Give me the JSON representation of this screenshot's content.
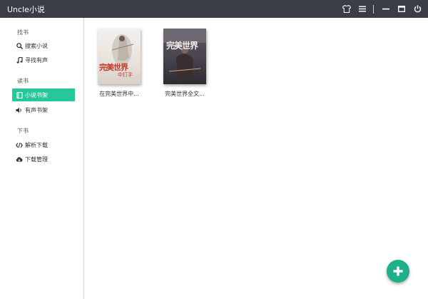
{
  "app": {
    "title": "Uncle小说"
  },
  "sidebar": {
    "sections": [
      {
        "label": "找书",
        "items": [
          {
            "label": "搜索小说",
            "icon": "search-icon"
          },
          {
            "label": "寻找有声",
            "icon": "music-note-icon"
          }
        ]
      },
      {
        "label": "读书",
        "items": [
          {
            "label": "小说书架",
            "icon": "book-icon",
            "active": true
          },
          {
            "label": "有声书架",
            "icon": "speaker-icon"
          }
        ]
      },
      {
        "label": "下书",
        "items": [
          {
            "label": "解析下载",
            "icon": "code-icon"
          },
          {
            "label": "下载管理",
            "icon": "cloud-download-icon"
          }
        ]
      }
    ]
  },
  "books": [
    {
      "title": "在完美世界中...",
      "cover_text": "完美世界",
      "cover_sub": "中打手"
    },
    {
      "title": "完美世界全文...",
      "cover_text": "完美世界"
    }
  ],
  "colors": {
    "titlebar": "#3a3d47",
    "accent": "#26c79a",
    "fab": "#1fb08a"
  }
}
